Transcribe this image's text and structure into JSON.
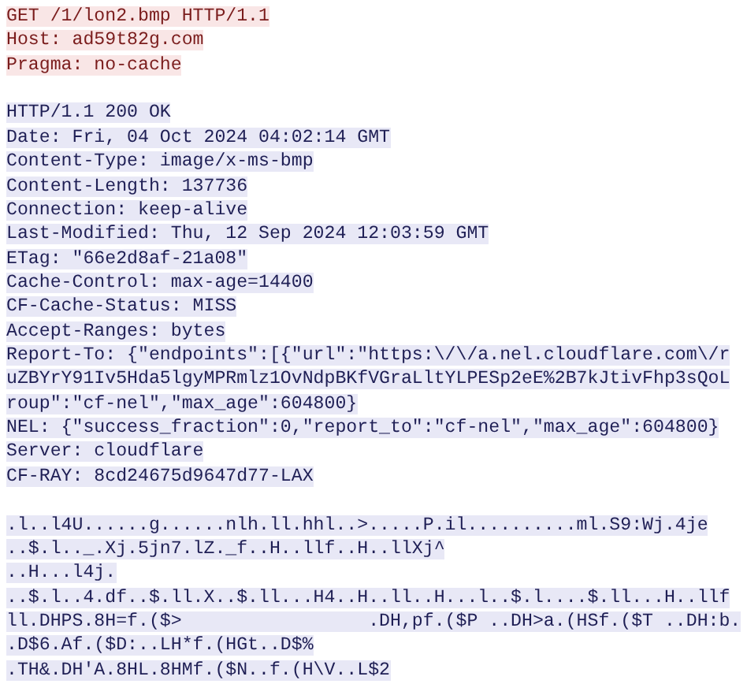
{
  "stream": [
    {
      "kind": "request",
      "lines": [
        "GET /1/lon2.bmp HTTP/1.1",
        "Host: ad59t82g.com",
        "Pragma: no-cache"
      ]
    },
    {
      "kind": "response",
      "lines": [
        "HTTP/1.1 200 OK",
        "Date: Fri, 04 Oct 2024 04:02:14 GMT",
        "Content-Type: image/x-ms-bmp",
        "Content-Length: 137736",
        "Connection: keep-alive",
        "Last-Modified: Thu, 12 Sep 2024 12:03:59 GMT",
        "ETag: \"66e2d8af-21a08\"",
        "Cache-Control: max-age=14400",
        "CF-Cache-Status: MISS",
        "Accept-Ranges: bytes",
        "Report-To: {\"endpoints\":[{\"url\":\"https:\\/\\/a.nel.cloudflare.com\\/r",
        "uZBYrY91Iv5Hda5lgyMPRmlz1OvNdpBKfVGraLltYLPESp2eE%2B7kJtivFhp3sQoL",
        "roup\":\"cf-nel\",\"max_age\":604800}",
        "NEL: {\"success_fraction\":0,\"report_to\":\"cf-nel\",\"max_age\":604800}",
        "Server: cloudflare",
        "CF-RAY: 8cd24675d9647d77-LAX"
      ]
    },
    {
      "kind": "response",
      "lines": [
        ".l..l4U......g......nlh.ll.hhl..>.....P.il..........ml.S9:Wj.4je",
        "..$.l.._.Xj.5jn7.lZ._f..H..llf..H..llXj^",
        "..H...l4j.",
        "..$.l..4.df..$.ll.X..$.ll...H4..H..ll..H...l..$.l....$.ll...H..llf",
        "ll.DHPS.8H=f.($>                 .DH,pf.($P ..DH>a.(HSf.($T ..DH:b.",
        ".D$6.Af.($D:..LH*f.(HGt..D$%",
        ".TH&.DH'A.8HL.8HMf.($N..f.(H\\V..L$2"
      ]
    }
  ]
}
